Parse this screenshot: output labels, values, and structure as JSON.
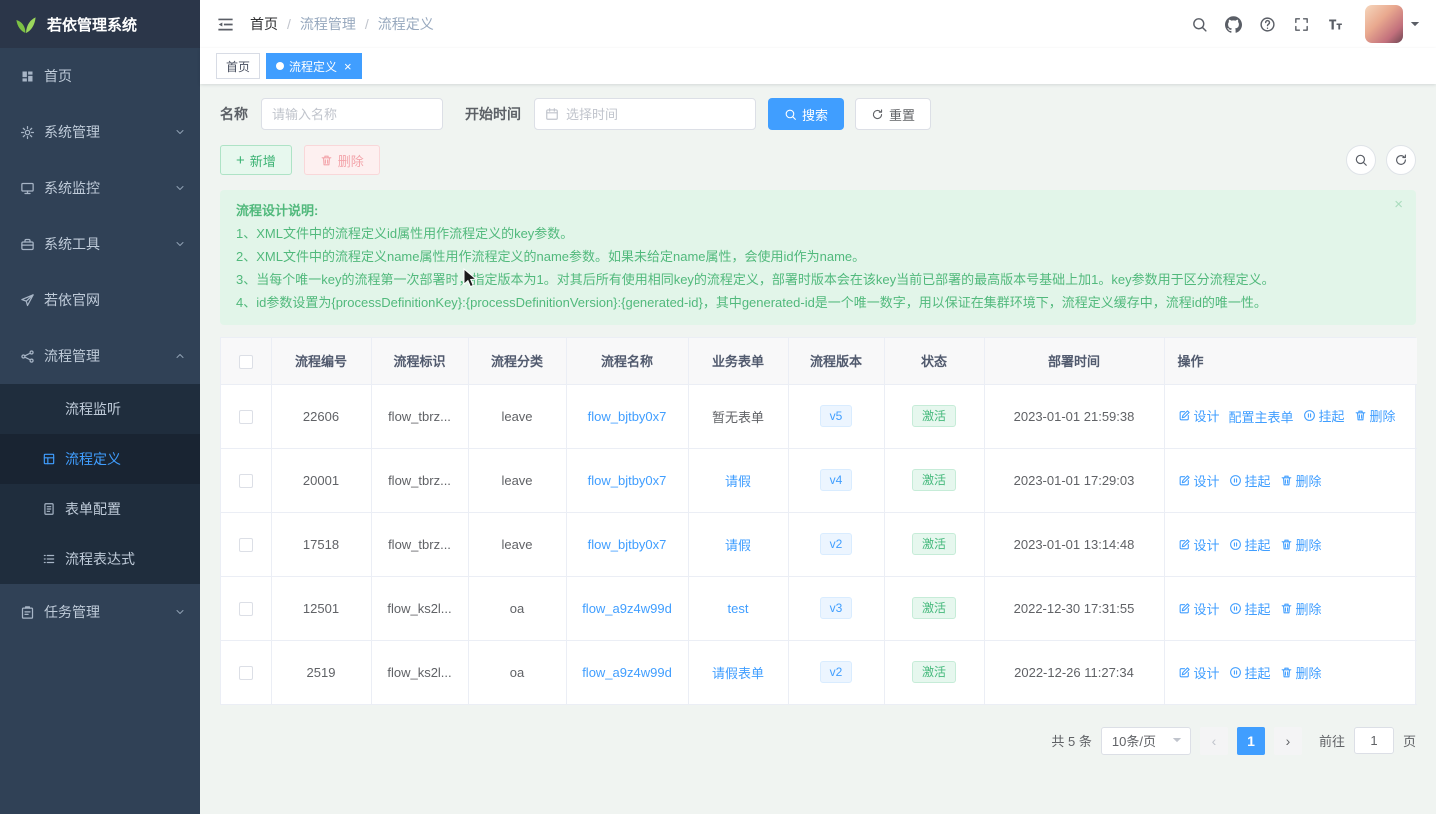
{
  "app": {
    "title": "若依管理系统"
  },
  "colors": {
    "accent": "#409eff",
    "success": "#67c23a",
    "danger": "#f56c6c",
    "sidebar_bg": "#304156",
    "submenu_bg": "#1f2d3d",
    "notice_bg": "#e2f5e9",
    "version_tag_bg": "#ecf5ff",
    "status_tag_bg": "#e6f7ee"
  },
  "sidebar": {
    "logo_title": "若依管理系统",
    "items": [
      {
        "name": "home",
        "label": "首页",
        "icon": "dashboard"
      },
      {
        "name": "system-admin",
        "label": "系统管理",
        "icon": "gear",
        "arrow": true
      },
      {
        "name": "system-monitor",
        "label": "系统监控",
        "icon": "monitor",
        "arrow": true
      },
      {
        "name": "system-tools",
        "label": "系统工具",
        "icon": "tool",
        "arrow": true
      },
      {
        "name": "official-site",
        "label": "若依官网",
        "icon": "guide"
      },
      {
        "name": "process-mgmt",
        "label": "流程管理",
        "icon": "flow",
        "arrow": true,
        "expanded": true,
        "children": [
          {
            "name": "process-listener",
            "label": "流程监听"
          },
          {
            "name": "process-definition",
            "label": "流程定义",
            "icon": "define",
            "active": true
          },
          {
            "name": "form-config",
            "label": "表单配置",
            "icon": "form"
          },
          {
            "name": "process-expression",
            "label": "流程表达式",
            "icon": "expression"
          }
        ]
      },
      {
        "name": "task-mgmt",
        "label": "任务管理",
        "icon": "task",
        "arrow": true
      }
    ]
  },
  "header": {
    "breadcrumb": [
      "首页",
      "流程管理",
      "流程定义"
    ],
    "icons": [
      "search",
      "github",
      "question",
      "fullscreen",
      "font-size"
    ]
  },
  "tabs": [
    {
      "name": "home",
      "label": "首页",
      "active": false,
      "closable": false
    },
    {
      "name": "process-definition",
      "label": "流程定义",
      "active": true,
      "closable": true
    }
  ],
  "filters": {
    "name_label": "名称",
    "name_placeholder": "请输入名称",
    "time_label": "开始时间",
    "time_placeholder": "选择时间",
    "search_label": "搜索",
    "reset_label": "重置"
  },
  "toolbar": {
    "add_label": "新增",
    "delete_label": "删除"
  },
  "notice": {
    "title": "流程设计说明:",
    "lines": [
      "1、XML文件中的流程定义id属性用作流程定义的key参数。",
      "2、XML文件中的流程定义name属性用作流程定义的name参数。如果未给定name属性，会使用id作为name。",
      "3、当每个唯一key的流程第一次部署时，指定版本为1。对其后所有使用相同key的流程定义，部署时版本会在该key当前已部署的最高版本号基础上加1。key参数用于区分流程定义。",
      "4、id参数设置为{processDefinitionKey}:{processDefinitionVersion}:{generated-id}，其中generated-id是一个唯一数字，用以保证在集群环境下，流程定义缓存中，流程id的唯一性。"
    ]
  },
  "table": {
    "columns": [
      "流程编号",
      "流程标识",
      "流程分类",
      "流程名称",
      "业务表单",
      "流程版本",
      "状态",
      "部署时间",
      "操作"
    ],
    "rows": [
      {
        "code": "22606",
        "key": "flow_tbrz...",
        "category": "leave",
        "name": "flow_bjtby0x7",
        "form": {
          "label": "暂无表单",
          "link": false
        },
        "version": "v5",
        "status": "激活",
        "time": "2023-01-01 21:59:38",
        "ops": [
          {
            "name": "design",
            "label": "设计",
            "icon": "edit"
          },
          {
            "name": "configure-main-form",
            "label": "配置主表单",
            "icon": ""
          },
          {
            "name": "suspend",
            "label": "挂起",
            "icon": "pause"
          },
          {
            "name": "delete",
            "label": "删除",
            "icon": "trash"
          }
        ]
      },
      {
        "code": "20001",
        "key": "flow_tbrz...",
        "category": "leave",
        "name": "flow_bjtby0x7",
        "form": {
          "label": "请假",
          "link": true
        },
        "version": "v4",
        "status": "激活",
        "time": "2023-01-01 17:29:03",
        "ops": [
          {
            "name": "design",
            "label": "设计",
            "icon": "edit"
          },
          {
            "name": "suspend",
            "label": "挂起",
            "icon": "pause"
          },
          {
            "name": "delete",
            "label": "删除",
            "icon": "trash"
          }
        ]
      },
      {
        "code": "17518",
        "key": "flow_tbrz...",
        "category": "leave",
        "name": "flow_bjtby0x7",
        "form": {
          "label": "请假",
          "link": true
        },
        "version": "v2",
        "status": "激活",
        "time": "2023-01-01 13:14:48",
        "ops": [
          {
            "name": "design",
            "label": "设计",
            "icon": "edit"
          },
          {
            "name": "suspend",
            "label": "挂起",
            "icon": "pause"
          },
          {
            "name": "delete",
            "label": "删除",
            "icon": "trash"
          }
        ]
      },
      {
        "code": "12501",
        "key": "flow_ks2l...",
        "category": "oa",
        "name": "flow_a9z4w99d",
        "form": {
          "label": "test",
          "link": true
        },
        "version": "v3",
        "status": "激活",
        "time": "2022-12-30 17:31:55",
        "ops": [
          {
            "name": "design",
            "label": "设计",
            "icon": "edit"
          },
          {
            "name": "suspend",
            "label": "挂起",
            "icon": "pause"
          },
          {
            "name": "delete",
            "label": "删除",
            "icon": "trash"
          }
        ]
      },
      {
        "code": "2519",
        "key": "flow_ks2l...",
        "category": "oa",
        "name": "flow_a9z4w99d",
        "form": {
          "label": "请假表单",
          "link": true
        },
        "version": "v2",
        "status": "激活",
        "time": "2022-12-26 11:27:34",
        "ops": [
          {
            "name": "design",
            "label": "设计",
            "icon": "edit"
          },
          {
            "name": "suspend",
            "label": "挂起",
            "icon": "pause"
          },
          {
            "name": "delete",
            "label": "删除",
            "icon": "trash"
          }
        ]
      }
    ]
  },
  "pagination": {
    "total_label": "共 5 条",
    "page_size": "10条/页",
    "current_page": "1",
    "goto_label": "前往",
    "goto_value": "1",
    "unit_label": "页"
  }
}
